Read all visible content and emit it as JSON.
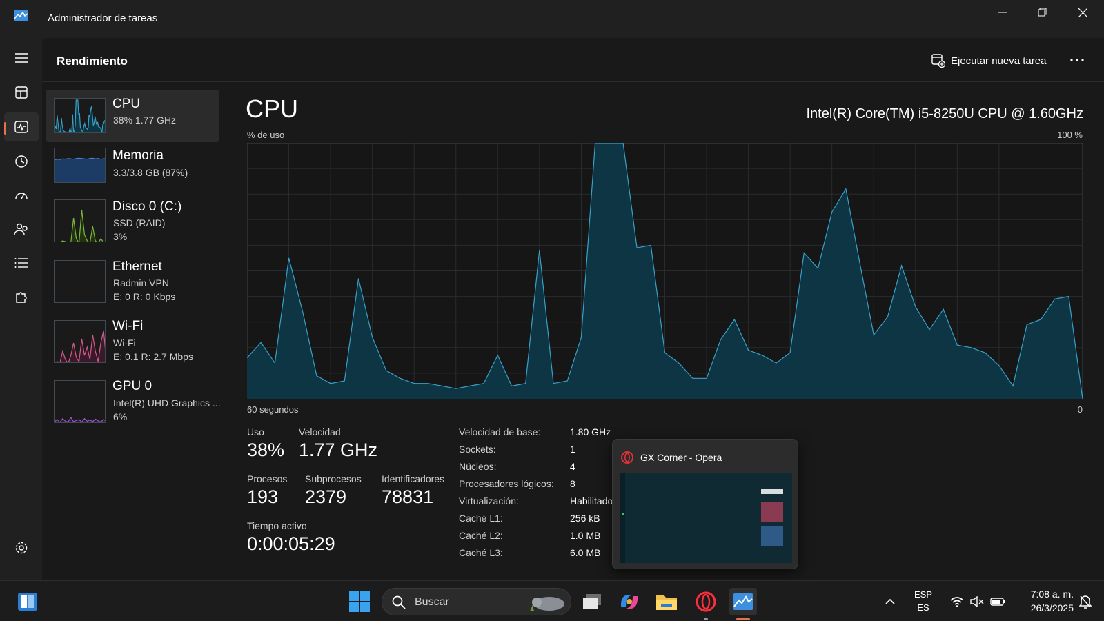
{
  "window": {
    "title": "Administrador de tareas"
  },
  "header": {
    "title": "Rendimiento",
    "new_task_label": "Ejecutar nueva tarea"
  },
  "devices": [
    {
      "name": "CPU",
      "line1": "38%  1.77 GHz",
      "line2": "",
      "color": "#3aa0c8"
    },
    {
      "name": "Memoria",
      "line1": "3.3/3.8 GB (87%)",
      "line2": "",
      "color": "#4a7fd4"
    },
    {
      "name": "Disco 0 (C:)",
      "line1": "SSD (RAID)",
      "line2": "3%",
      "color": "#7ab83a"
    },
    {
      "name": "Ethernet",
      "line1": "Radmin VPN",
      "line2": "E: 0  R: 0 Kbps",
      "color": "#c27bc8"
    },
    {
      "name": "Wi-Fi",
      "line1": "Wi-Fi",
      "line2": "E: 0.1  R: 2.7 Mbps",
      "color": "#d45a8a"
    },
    {
      "name": "GPU 0",
      "line1": "Intel(R) UHD Graphics ...",
      "line2": "6%",
      "color": "#9b59c8"
    }
  ],
  "cpu": {
    "title": "CPU",
    "model": "Intel(R) Core(TM) i5-8250U CPU @ 1.60GHz",
    "usage_label": "% de uso",
    "usage_max": "100 %",
    "time_label": "60 segundos",
    "time_end": "0",
    "graph_color": "#3aa0c8"
  },
  "chart_data": {
    "type": "area",
    "title": "",
    "xlabel": "60 segundos",
    "ylabel": "% de uso",
    "ylim": [
      0,
      100
    ],
    "x": [
      60,
      59,
      58,
      57,
      56,
      55,
      54,
      53,
      52,
      51,
      50,
      49,
      48,
      47,
      46,
      45,
      44,
      43,
      42,
      41,
      40,
      39,
      38,
      37,
      36,
      35,
      34,
      33,
      32,
      31,
      30,
      29,
      28,
      27,
      26,
      25,
      24,
      23,
      22,
      21,
      20,
      19,
      18,
      17,
      16,
      15,
      14,
      13,
      12,
      11,
      10,
      9,
      8,
      7,
      6,
      5,
      4,
      3,
      2,
      1,
      0
    ],
    "series": [
      {
        "values": [
          16,
          22,
          14,
          55,
          34,
          9,
          6,
          7,
          47,
          24,
          11,
          8,
          6,
          6,
          5,
          4,
          5,
          6,
          17,
          5,
          6,
          58,
          6,
          7,
          24,
          100,
          100,
          100,
          59,
          60,
          18,
          14,
          8,
          8,
          23,
          31,
          19,
          17,
          14,
          18,
          57,
          51,
          73,
          82,
          53,
          25,
          32,
          52,
          36,
          27,
          35,
          21,
          20,
          18,
          13,
          5,
          29,
          31,
          39,
          40,
          0
        ]
      }
    ]
  },
  "stats": {
    "uso_label": "Uso",
    "uso_value": "38%",
    "velocidad_label": "Velocidad",
    "velocidad_value": "1.77 GHz",
    "procesos_label": "Procesos",
    "procesos_value": "193",
    "subprocesos_label": "Subprocesos",
    "subprocesos_value": "2379",
    "identificadores_label": "Identificadores",
    "identificadores_value": "78831",
    "tiempo_label": "Tiempo activo",
    "tiempo_value": "0:00:05:29"
  },
  "specs": [
    {
      "label": "Velocidad de base:",
      "value": "1.80 GHz"
    },
    {
      "label": "Sockets:",
      "value": "1"
    },
    {
      "label": "Núcleos:",
      "value": "4"
    },
    {
      "label": "Procesadores lógicos:",
      "value": "8"
    },
    {
      "label": "Virtualización:",
      "value": "Habilitado"
    },
    {
      "label": "Caché L1:",
      "value": "256 kB"
    },
    {
      "label": "Caché L2:",
      "value": "1.0 MB"
    },
    {
      "label": "Caché L3:",
      "value": "6.0 MB"
    }
  ],
  "popup": {
    "title": "GX Corner - Opera"
  },
  "taskbar": {
    "search_placeholder": "Buscar",
    "lang_top": "ESP",
    "lang_bottom": "ES",
    "time": "7:08 a. m.",
    "date": "26/3/2025"
  },
  "colors": {
    "accent": "#e8734a",
    "graph_fill": "#0e3544",
    "graph_line": "#3aa0c8"
  }
}
